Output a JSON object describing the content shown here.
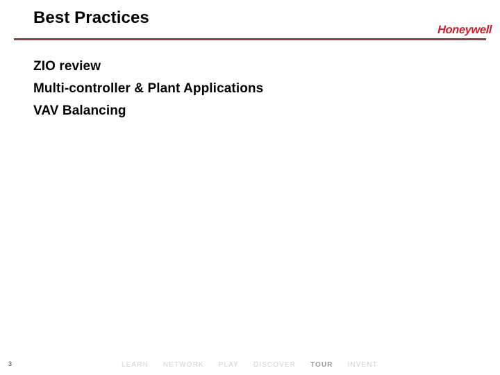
{
  "slide": {
    "title": "Best Practices",
    "page_number": "3",
    "accent_rule_color": "#8E4340",
    "brand_color": "#C8202C",
    "background_color": "#FFFFFF",
    "title_color": "#000000"
  },
  "brand": {
    "wordmark": "Honeywell"
  },
  "body": {
    "lines": [
      {
        "text": "ZIO review"
      },
      {
        "text": "Multi-controller & Plant Applications"
      },
      {
        "text": "VAV Balancing"
      }
    ]
  },
  "footer": {
    "tagline_words": [
      {
        "text": "LEARN",
        "emphasis": false
      },
      {
        "text": "NETWORK",
        "emphasis": false
      },
      {
        "text": "PLAY",
        "emphasis": false
      },
      {
        "text": "DISCOVER",
        "emphasis": false
      },
      {
        "text": "TOUR",
        "emphasis": true
      },
      {
        "text": "INVENT",
        "emphasis": false
      }
    ]
  }
}
